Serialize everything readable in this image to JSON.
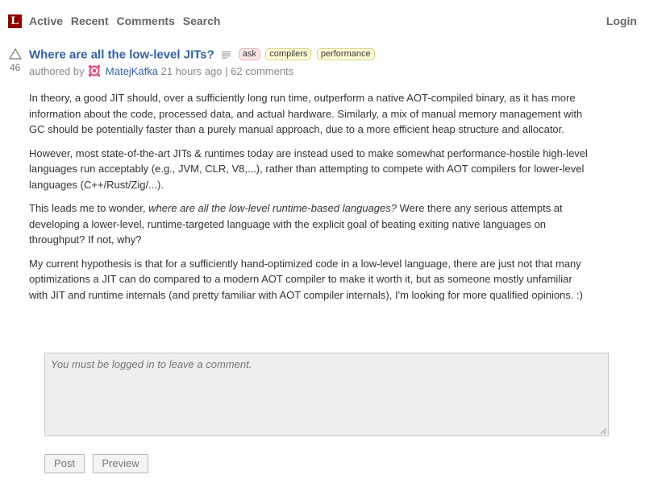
{
  "header": {
    "logo_letter": "L",
    "nav": [
      "Active",
      "Recent",
      "Comments",
      "Search"
    ],
    "login": "Login"
  },
  "story": {
    "score": "46",
    "title": "Where are all the low-level JITs?",
    "text_post_icon": "text-lines-icon",
    "tags": [
      "ask",
      "compilers",
      "performance"
    ],
    "byline": {
      "authored_by": "authored by",
      "user": "MatejKafka",
      "time": "21 hours ago",
      "separator": "|",
      "comments": "62 comments"
    },
    "paragraphs": [
      {
        "text": "In theory, a good JIT should, over a sufficiently long run time, outperform a native AOT-compiled binary, as it has more information about the code, processed data, and actual hardware. Similarly, a mix of manual memory management with GC should be potentially faster than a purely manual approach, due to a more efficient heap structure and allocator."
      },
      {
        "text": "However, most state-of-the-art JITs & runtimes today are instead used to make somewhat performance-hostile high-level languages run acceptably (e.g., JVM, CLR, V8,...), rather than attempting to compete with AOT compilers for lower-level languages (C++/Rust/Zig/...)."
      },
      {
        "before": "This leads me to wonder, ",
        "em": "where are all the low-level runtime-based languages?",
        "after": " Were there any serious attempts at developing a lower-level, runtime-targeted language with the explicit goal of beating exiting native languages on throughput? If not, why?"
      },
      {
        "text": "My current hypothesis is that for a sufficiently hand-optimized code in a low-level language, there are just not that many optimizations a JIT can do compared to a modern AOT compiler to make it worth it, but as someone mostly unfamiliar with JIT and runtime internals (and pretty familiar with AOT compiler internals), I'm looking for more qualified opinions. :)"
      }
    ]
  },
  "comment_form": {
    "placeholder": "You must be logged in to leave a comment.",
    "post_label": "Post",
    "preview_label": "Preview"
  },
  "colors": {
    "logo_bg": "#8f0000",
    "link": "#3361a8",
    "tag_bg": "#fffcd7",
    "ask_tag_bg": "#fbe6e6"
  }
}
